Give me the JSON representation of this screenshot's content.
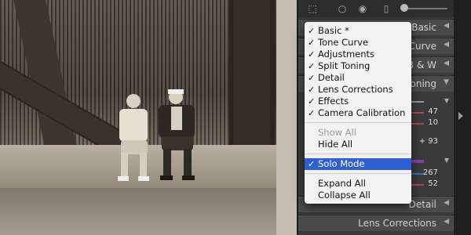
{
  "toolbar": {
    "icons": [
      "grid-select-icon",
      "circle-tool-icon",
      "radial-filter-icon",
      "brush-icon",
      "slider-icon"
    ]
  },
  "panel": {
    "sections": [
      {
        "key": "basic",
        "label": "Basic"
      },
      {
        "key": "tone-curve",
        "label": "Tone Curve"
      },
      {
        "key": "hsl",
        "label": "B & W"
      },
      {
        "key": "split-toning",
        "label": "Toning"
      },
      {
        "key": "detail",
        "label": "Detail"
      },
      {
        "key": "lens-corrections",
        "label": "Lens Corrections"
      }
    ],
    "values": {
      "v1": "47",
      "v2": "10",
      "v3": "+ 93",
      "v4": "267",
      "v5": "52"
    }
  },
  "menu": {
    "items": [
      {
        "label": "Basic *",
        "checked": true
      },
      {
        "label": "Tone Curve",
        "checked": true
      },
      {
        "label": "Adjustments",
        "checked": true
      },
      {
        "label": "Split Toning",
        "checked": true
      },
      {
        "label": "Detail",
        "checked": true
      },
      {
        "label": "Lens Corrections",
        "checked": true
      },
      {
        "label": "Effects",
        "checked": true
      },
      {
        "label": "Camera Calibration",
        "checked": true
      }
    ],
    "show_all": "Show All",
    "hide_all": "Hide All",
    "solo_mode": "Solo Mode",
    "expand_all": "Expand All",
    "collapse_all": "Collapse All",
    "check_mark": "✓"
  },
  "colors": {
    "menu_highlight": "#2f5fd3",
    "panel_bg": "#3a3a3a"
  }
}
